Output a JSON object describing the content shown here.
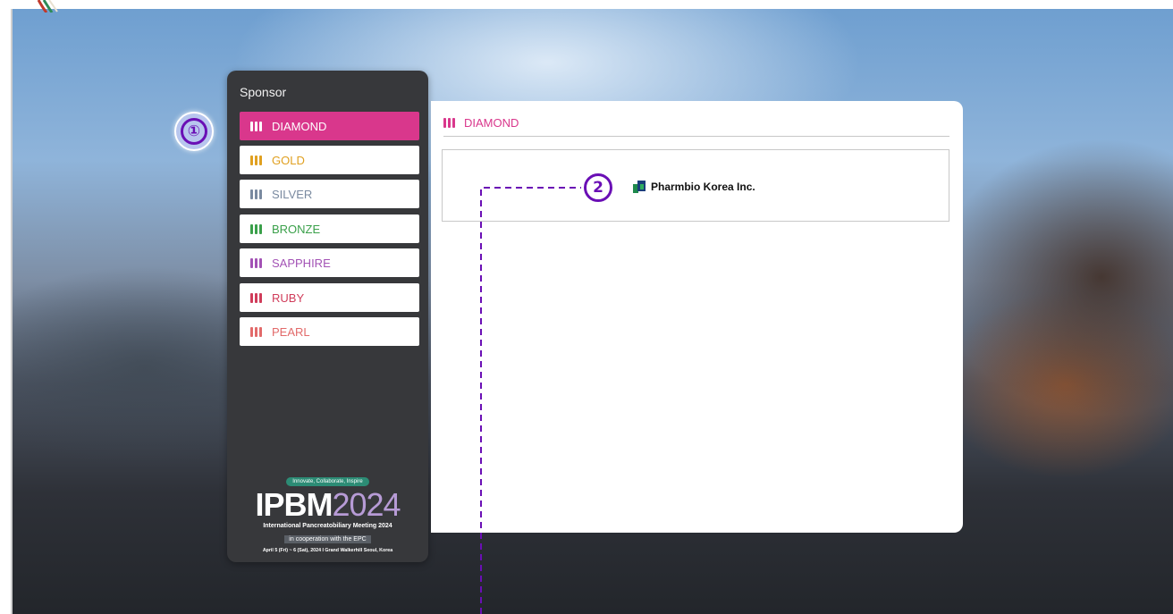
{
  "sidebar": {
    "title": "Sponsor",
    "items": [
      {
        "label": "DIAMOND",
        "color": "#d9378c",
        "active": true
      },
      {
        "label": "GOLD",
        "color": "#e0a020",
        "active": false
      },
      {
        "label": "SILVER",
        "color": "#7a8aa0",
        "active": false
      },
      {
        "label": "BRONZE",
        "color": "#3aa04a",
        "active": false
      },
      {
        "label": "SAPPHIRE",
        "color": "#a352b5",
        "active": false
      },
      {
        "label": "RUBY",
        "color": "#d03c5a",
        "active": false
      },
      {
        "label": "PEARL",
        "color": "#e26a6a",
        "active": false
      }
    ],
    "brand": {
      "tagline": "Innovate, Collaborate, Inspire",
      "name_letters": "IPBM",
      "name_year": "2024",
      "meeting": "International Pancreatobiliary Meeting 2024",
      "cooperation": "in cooperation with the EPC",
      "dates": "April 5 (Fri) ~ 6 (Sat), 2024 I Grand Walkerhill Seoul, Korea"
    }
  },
  "panel": {
    "header": "DIAMOND",
    "sponsors": [
      {
        "name": "Pharmbio Korea Inc."
      }
    ]
  },
  "annotations": {
    "step1": "①",
    "step2": "2"
  },
  "colors": {
    "accent": "#d9378c",
    "annotation": "#6a0fb5",
    "sidebar_bg": "#37383b"
  }
}
